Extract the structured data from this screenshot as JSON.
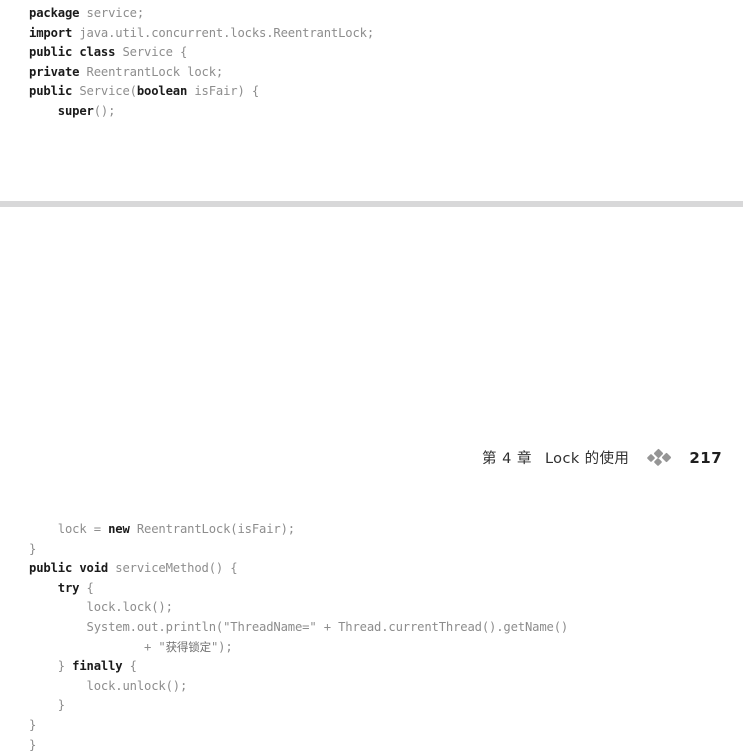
{
  "document": {
    "type": "scanned-book-page",
    "background_color": "#ffffff",
    "separator_color": "#d8d8d9"
  },
  "running_header": {
    "chapter": "第 4 章",
    "title": "Lock 的使用",
    "ornament": "diamond-cluster-ornament",
    "page_number": "217"
  },
  "code_top": {
    "language": "java",
    "lines": [
      [
        {
          "t": "package",
          "s": "kw"
        },
        {
          "t": " service;",
          "s": "pl"
        }
      ],
      [
        {
          "t": "import",
          "s": "kw"
        },
        {
          "t": " java.util.concurrent.locks.ReentrantLock;",
          "s": "pl"
        }
      ],
      [
        {
          "t": "public class",
          "s": "kw"
        },
        {
          "t": " Service {",
          "s": "pl"
        }
      ],
      [
        {
          "t": "private",
          "s": "kw"
        },
        {
          "t": " ReentrantLock lock;",
          "s": "pl"
        }
      ],
      [
        {
          "t": "public",
          "s": "kw"
        },
        {
          "t": " Service(",
          "s": "pl"
        },
        {
          "t": "boolean",
          "s": "kw"
        },
        {
          "t": " isFair) {",
          "s": "pl"
        }
      ],
      [
        {
          "t": "    ",
          "s": "pl"
        },
        {
          "t": "super",
          "s": "kw"
        },
        {
          "t": "();",
          "s": "pl"
        }
      ]
    ]
  },
  "code_bottom": {
    "language": "java",
    "lines": [
      [
        {
          "t": "    lock = ",
          "s": "pl"
        },
        {
          "t": "new",
          "s": "kw"
        },
        {
          "t": " ReentrantLock(isFair);",
          "s": "pl"
        }
      ],
      [
        {
          "t": "}",
          "s": "pl"
        }
      ],
      [
        {
          "t": "public void",
          "s": "kw"
        },
        {
          "t": " serviceMethod() {",
          "s": "pl"
        }
      ],
      [
        {
          "t": "    ",
          "s": "pl"
        },
        {
          "t": "try",
          "s": "kw"
        },
        {
          "t": " {",
          "s": "pl"
        }
      ],
      [
        {
          "t": "        lock.lock();",
          "s": "pl"
        }
      ],
      [
        {
          "t": "        System.out.println(\"ThreadName=\" + Thread.currentThread().getName()",
          "s": "pl"
        }
      ],
      [
        {
          "t": "                + \"",
          "s": "pl"
        },
        {
          "t": "获得锁定",
          "s": "cjk"
        },
        {
          "t": "\");",
          "s": "pl"
        }
      ],
      [
        {
          "t": "    } ",
          "s": "pl"
        },
        {
          "t": "finally",
          "s": "kw"
        },
        {
          "t": " {",
          "s": "pl"
        }
      ],
      [
        {
          "t": "        lock.unlock();",
          "s": "pl"
        }
      ],
      [
        {
          "t": "    }",
          "s": "pl"
        }
      ],
      [
        {
          "t": "}",
          "s": "pl"
        }
      ],
      [
        {
          "t": "}",
          "s": "pl"
        }
      ]
    ]
  }
}
